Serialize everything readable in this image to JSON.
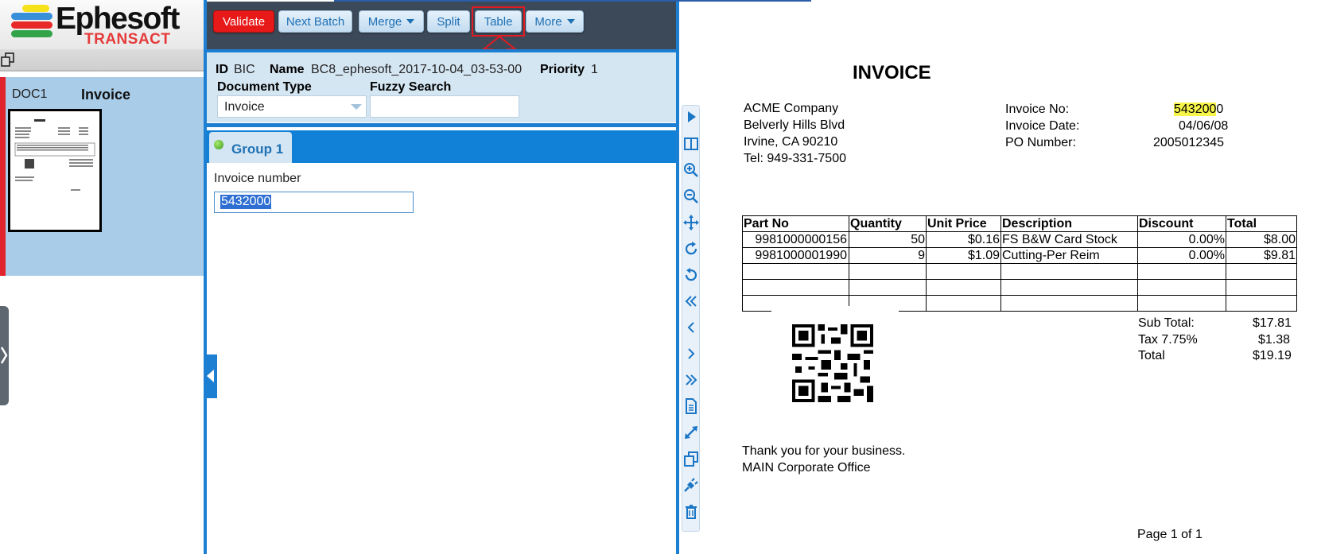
{
  "app": {
    "logo_word": "Ephesoft",
    "logo_sub": "TRANSACT"
  },
  "document_list": {
    "doc_id": "DOC1",
    "doc_type": "Invoice"
  },
  "toolbar": {
    "validate": "Validate",
    "next_batch": "Next Batch",
    "merge": "Merge",
    "split": "Split",
    "table": "Table",
    "more": "More"
  },
  "batch": {
    "id_label": "ID",
    "id_value": "BIC",
    "name_label": "Name",
    "name_value": "BC8_ephesoft_2017-10-04_03-53-00",
    "priority_label": "Priority",
    "priority_value": "1",
    "doc_type_label": "Document Type",
    "doc_type_value": "Invoice",
    "fuzzy_label": "Fuzzy Search",
    "fuzzy_value": ""
  },
  "group": {
    "tab_label": "Group 1",
    "field_label": "Invoice number",
    "field_value": "5432000"
  },
  "vertical_tools": [
    "play-icon",
    "split-view-icon",
    "zoom-in-icon",
    "zoom-out-icon",
    "move-icon",
    "rotate-cw-icon",
    "rotate-ccw-icon",
    "first-page-icon",
    "prev-page-icon",
    "next-page-icon",
    "last-page-icon",
    "document-icon",
    "fit-icon",
    "copy-icon",
    "plugin-icon",
    "delete-icon"
  ],
  "invoice": {
    "title": "INVOICE",
    "company": [
      "ACME Company",
      "Belverly Hills Blvd",
      "Irvine, CA 90210",
      "Tel: 949-331-7500"
    ],
    "meta_labels": [
      "Invoice No:",
      "Invoice Date:",
      "PO Number:"
    ],
    "invoice_no_highlight": "543200",
    "invoice_no_tail": "0",
    "invoice_date": "04/06/08",
    "po_number": "2005012345",
    "table_headers": [
      "Part No",
      "Quantity",
      "Unit Price",
      "Description",
      "Discount",
      "Total"
    ],
    "rows": [
      [
        "9981000000156",
        "50",
        "$0.16",
        "FS B&W Card Stock",
        "0.00%",
        "$8.00"
      ],
      [
        "9981000001990",
        "9",
        "$1.09",
        "Cutting-Per Reim",
        "0.00%",
        "$9.81"
      ]
    ],
    "subtotal_label": "Sub Total:",
    "subtotal": "$17.81",
    "tax_label": "Tax 7.75%",
    "tax": "$1.38",
    "total_label": "Total",
    "total": "$19.19",
    "thanks": "Thank you for your business.",
    "office": "MAIN Corporate Office",
    "page": "Page 1 of 1"
  }
}
